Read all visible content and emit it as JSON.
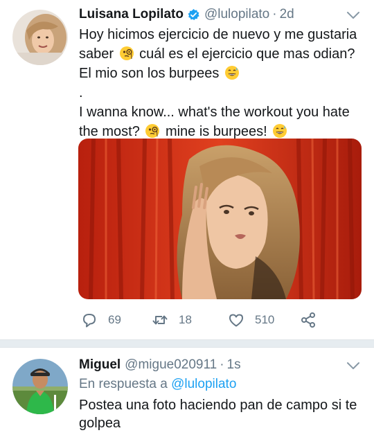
{
  "tweet": {
    "author_name": "Luisana Lopilato",
    "handle": "@lulopilato",
    "separator": "·",
    "time": "2d",
    "verified": true,
    "text_es_1": "Hoy hicimos ejercicio de nuevo y me gustaria saber",
    "text_es_2": "cuál es el ejercicio que mas odian? El mio son los burpees",
    "dot": ".",
    "text_en_1": "I wanna know... what's the workout you hate the most?",
    "text_en_2": "mine is burpees!",
    "emoji_1": "thinking-monocle-emoji",
    "emoji_2": "grinning-sweat-emoji",
    "actions": {
      "replies": "69",
      "retweets": "18",
      "likes": "510"
    }
  },
  "reply": {
    "author_name": "Miguel",
    "handle": "@migue020911",
    "separator": "·",
    "time": "1s",
    "reply_prefix": "En respuesta a",
    "reply_mention": "@lulopilato",
    "text": "Postea una foto haciendo pan de campo si te golpea"
  },
  "colors": {
    "link": "#1da1f2",
    "secondary": "#657786",
    "divider": "#e6ecf0",
    "curtain": "#d8321a"
  }
}
